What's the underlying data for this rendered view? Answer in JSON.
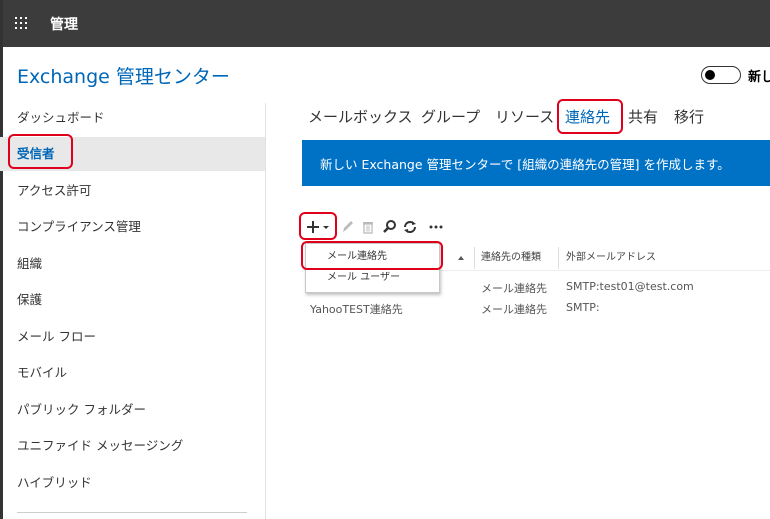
{
  "topbar": {
    "title": "管理",
    "waffle_icon": "app-launcher-icon"
  },
  "app": {
    "title": "Exchange 管理センター",
    "toggle_label": "新し"
  },
  "sidebar": {
    "items": [
      {
        "label": "ダッシュボード"
      },
      {
        "label": "受信者",
        "active": true
      },
      {
        "label": "アクセス許可"
      },
      {
        "label": "コンプライアンス管理"
      },
      {
        "label": "組織"
      },
      {
        "label": "保護"
      },
      {
        "label": "メール フロー"
      },
      {
        "label": "モバイル"
      },
      {
        "label": "パブリック フォルダー"
      },
      {
        "label": "ユニファイド メッセージング"
      },
      {
        "label": "ハイブリッド"
      }
    ]
  },
  "tabs": [
    {
      "label": "メールボックス"
    },
    {
      "label": "グループ"
    },
    {
      "label": "リソース"
    },
    {
      "label": "連絡先",
      "active": true
    },
    {
      "label": "共有"
    },
    {
      "label": "移行"
    }
  ],
  "banner": {
    "text": "新しい Exchange 管理センターで [組織の連絡先の管理] を作成します。"
  },
  "toolbar": {
    "icons": [
      "plus-icon",
      "edit-icon",
      "delete-icon",
      "search-icon",
      "refresh-icon",
      "more-icon"
    ]
  },
  "table": {
    "columns": [
      "連絡先の種類",
      "外部メールアドレス"
    ],
    "rows": [
      {
        "name": "",
        "type": "メール連絡先",
        "email": "SMTP:test01@test.com"
      },
      {
        "name": "YahooTEST連絡先",
        "type": "メール連絡先",
        "email": "SMTP:"
      }
    ]
  },
  "dropdown": {
    "items": [
      {
        "label": "メール連絡先"
      },
      {
        "label": "メール ユーザー"
      }
    ]
  },
  "colors": {
    "accent": "#0067b8",
    "banner": "#0072c6",
    "highlight": "#e0001b",
    "topbar": "#3c3c3c"
  }
}
